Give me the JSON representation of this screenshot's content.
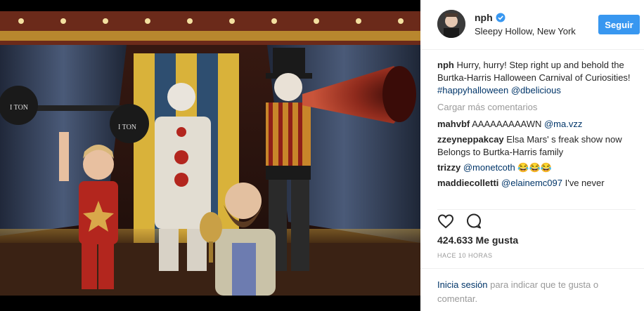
{
  "post": {
    "username": "nph",
    "verified": true,
    "location": "Sleepy Hollow, New York",
    "follow_label": "Seguir",
    "caption": {
      "username": "nph",
      "text": "Hurry, hurry! Step right up and behold the Burtka-Harris Halloween Carnival of Curiosities!",
      "hashtag": "#happyhalloween",
      "mention": "@dbelicious"
    },
    "load_more": "Cargar más comentarios",
    "comments": [
      {
        "user": "mahvbf",
        "text": "AAAAAAAAAWN",
        "mention": "@ma.vzz"
      },
      {
        "user": "zzeyneppakcay",
        "text": "Elsa Mars' s freak show now Belongs to Burtka-Harris family",
        "mention": ""
      },
      {
        "user": "trizzy",
        "text": "",
        "mention": "@monetcoth",
        "suffix": "😂😂😂"
      },
      {
        "user": "maddiecolletti",
        "text": "I've never",
        "mention": "@elainemc097"
      }
    ],
    "likes": "424.633 Me gusta",
    "time": "HACE 10 HORAS",
    "login": {
      "link": "Inicia sesión",
      "text": "para indicar que te gusta o comentar."
    }
  },
  "icons": [
    "heart-icon",
    "comment-icon",
    "verified-icon"
  ],
  "colors": {
    "accent": "#3897f0",
    "link": "#003569",
    "muted": "#999999"
  }
}
